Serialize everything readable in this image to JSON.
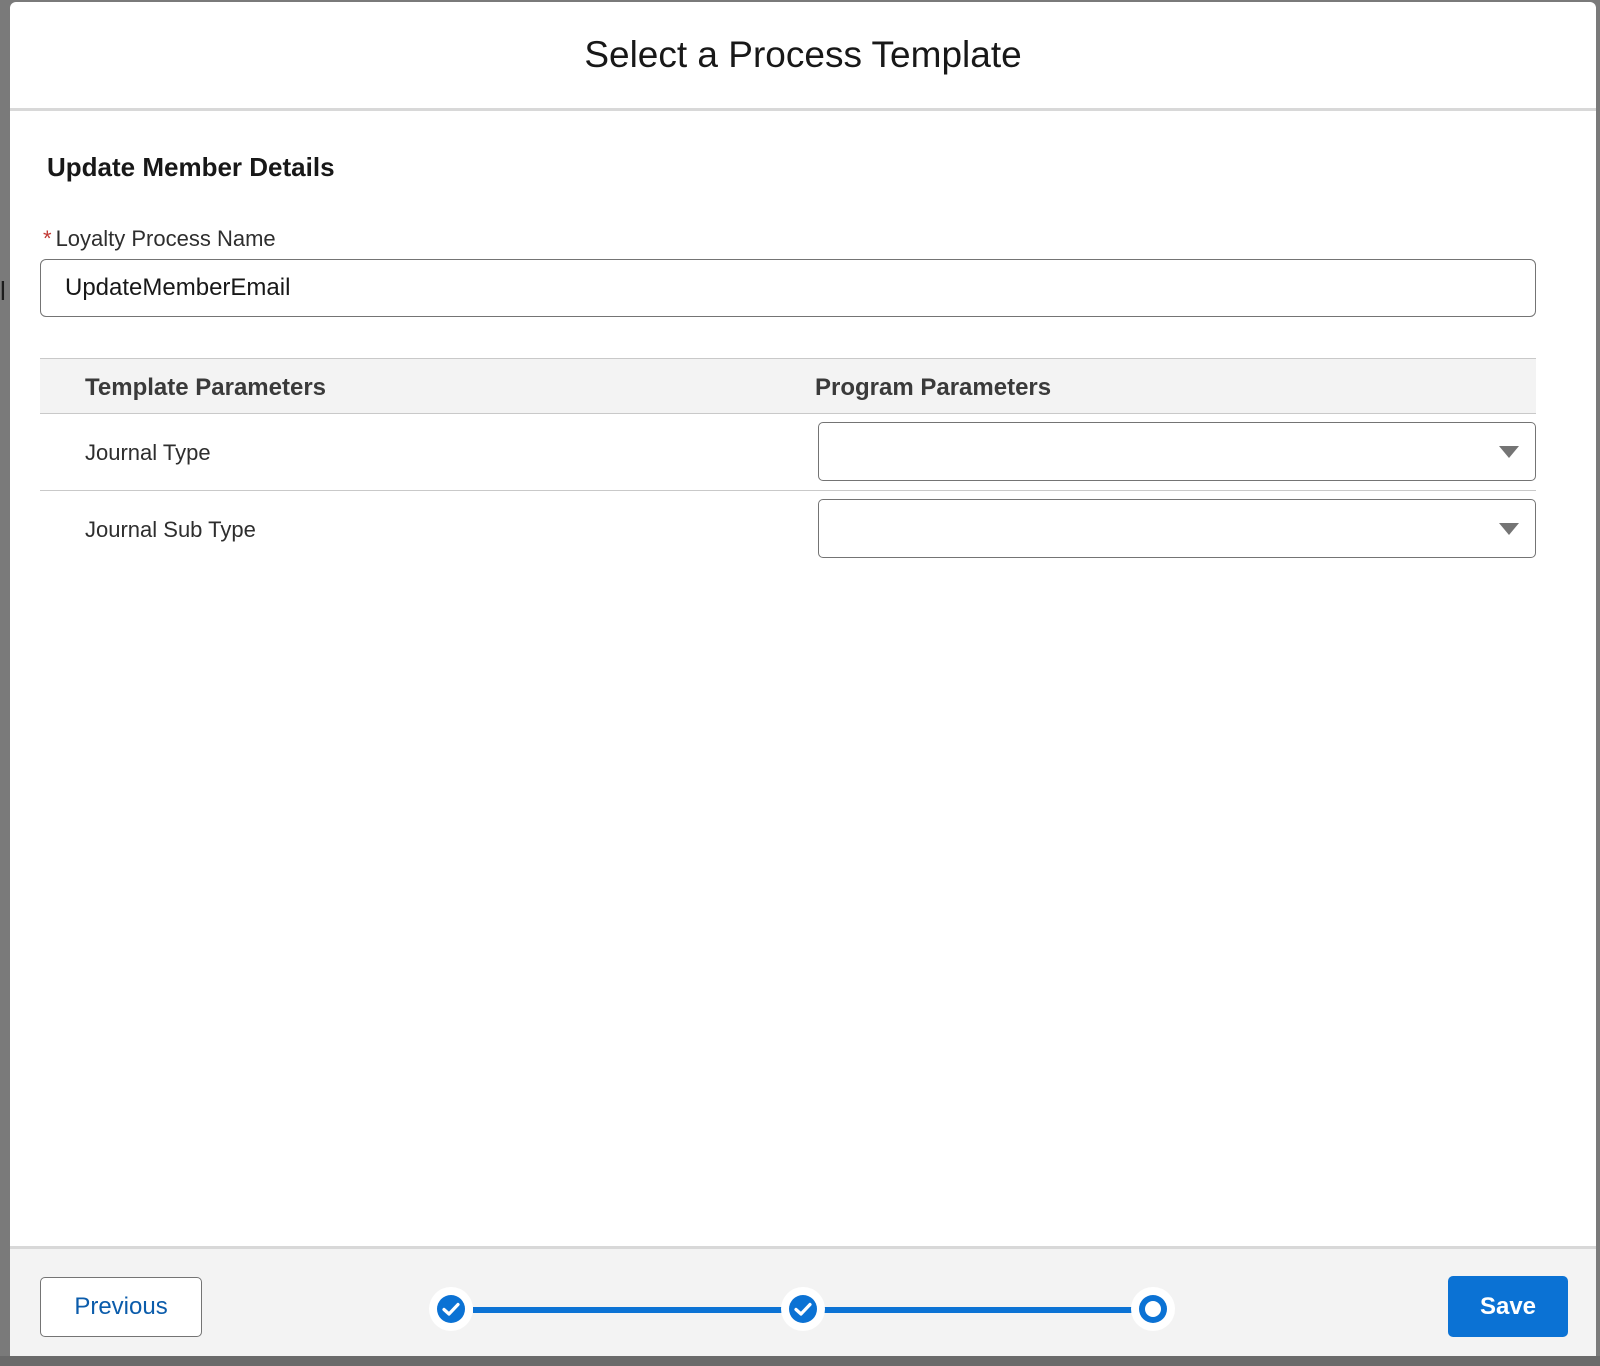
{
  "modal": {
    "title": "Select a Process Template"
  },
  "section": {
    "title": "Update Member Details"
  },
  "form": {
    "required_marker": "*",
    "name_label": "Loyalty Process Name",
    "name_value": "UpdateMemberEmail"
  },
  "table": {
    "headers": {
      "template": "Template Parameters",
      "program": "Program Parameters"
    },
    "rows": [
      {
        "label": "Journal Type",
        "value": ""
      },
      {
        "label": "Journal Sub Type",
        "value": ""
      }
    ]
  },
  "footer": {
    "previous_label": "Previous",
    "save_label": "Save",
    "progress": {
      "total_steps": 3,
      "completed_steps": 2,
      "current_step": 3
    }
  },
  "colors": {
    "brand": "#0b72d4",
    "link": "#0b5cab",
    "required": "#c23934"
  },
  "icons": {
    "completed_step": "check-circle-icon",
    "current_step": "ring-icon",
    "dropdown": "caret-down-icon"
  }
}
